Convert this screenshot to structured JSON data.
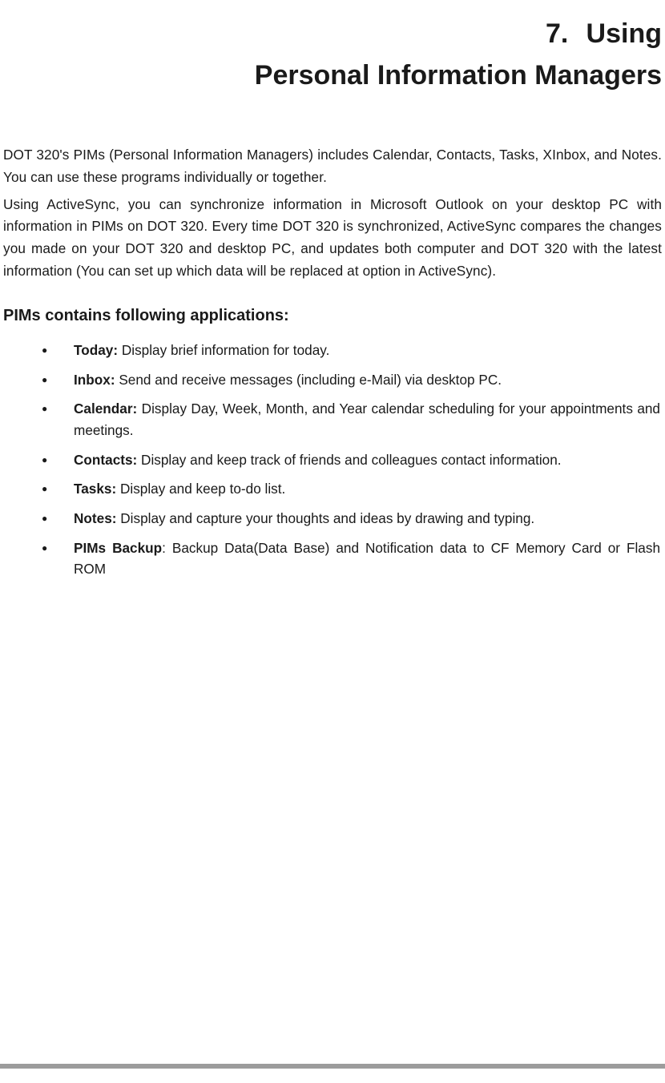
{
  "chapter": {
    "number": "7.",
    "title_top": "Using",
    "title_bottom": "Personal Information Managers"
  },
  "paragraphs": {
    "p1": "DOT 320's PIMs (Personal Information Managers) includes Calendar, Contacts, Tasks, XInbox, and Notes. You can use these programs individually or together.",
    "p2": "Using ActiveSync, you can synchronize information in Microsoft Outlook on your desktop PC with information in PIMs on DOT 320. Every time DOT 320 is synchronized, ActiveSync compares the changes you made on your DOT 320 and desktop PC, and updates both computer and DOT 320 with the latest information (You can set up which data will be replaced at option in ActiveSync)."
  },
  "subheading": "PIMs contains following applications:",
  "items": [
    {
      "label": "Today:",
      "text": " Display brief information for today."
    },
    {
      "label": "Inbox:",
      "text": " Send and receive messages (including e-Mail) via desktop PC."
    },
    {
      "label": "Calendar:",
      "text": " Display Day, Week, Month, and Year calendar scheduling for your appointments and meetings."
    },
    {
      "label": "Contacts:",
      "text": " Display and keep track of friends and colleagues contact information."
    },
    {
      "label": "Tasks:",
      "text": " Display and keep to-do list."
    },
    {
      "label": "Notes:",
      "text": " Display and capture your thoughts and ideas by drawing and typing."
    },
    {
      "label": "PIMs Backup",
      "text": ": Backup Data(Data Base) and Notification data to CF Memory Card or Flash ROM"
    }
  ]
}
